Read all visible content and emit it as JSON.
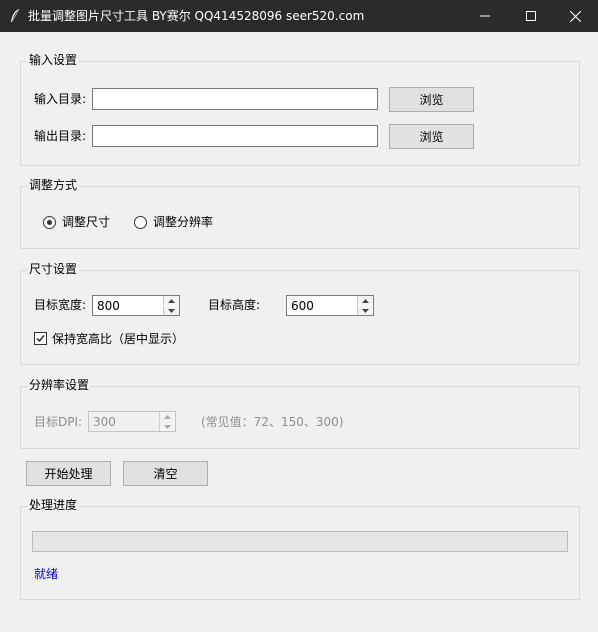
{
  "window": {
    "title": "批量调整图片尺寸工具 BY赛尔 QQ414528096 seer520.com",
    "icons": [
      "feather-icon",
      "minimize-icon",
      "maximize-icon",
      "close-icon"
    ]
  },
  "input_group": {
    "title": "输入设置",
    "input_dir_label": "输入目录:",
    "input_dir_value": "",
    "output_dir_label": "输出目录:",
    "output_dir_value": "",
    "browse_label": "浏览",
    "browse2_label": "浏览"
  },
  "mode_group": {
    "title": "调整方式",
    "option_size": "调整尺寸",
    "option_resolution": "调整分辨率",
    "selected": "调整尺寸"
  },
  "size_group": {
    "title": "尺寸设置",
    "width_label": "目标宽度:",
    "width_value": "800",
    "height_label": "目标高度:",
    "height_value": "600",
    "keep_ratio_label": "保持宽高比（居中显示）",
    "keep_ratio_checked": true
  },
  "dpi_group": {
    "title": "分辨率设置",
    "dpi_label": "目标DPI:",
    "dpi_value": "300",
    "hint": "(常见值：72、150、300)"
  },
  "actions": {
    "start_label": "开始处理",
    "clear_label": "清空"
  },
  "progress_group": {
    "title": "处理进度",
    "progress": 0,
    "status": "就绪"
  },
  "colors": {
    "titlebar": "#2b2b2b",
    "status": "#0000ff",
    "background": "#f0f0f0"
  }
}
